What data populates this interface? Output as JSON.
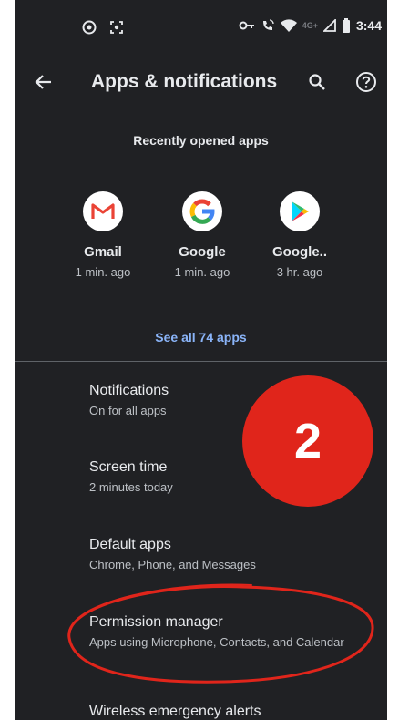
{
  "status_bar": {
    "time": "3:44",
    "network": "4G+",
    "icons": [
      "vpn-icon",
      "screen-record-icon",
      "key-icon",
      "wifi-calling-icon",
      "wifi-icon",
      "signal-icon",
      "battery-icon"
    ]
  },
  "toolbar": {
    "title": "Apps & notifications"
  },
  "recent": {
    "header": "Recently opened apps",
    "apps": [
      {
        "name": "Gmail",
        "time": "1 min. ago",
        "icon": "gmail-icon"
      },
      {
        "name": "Google",
        "time": "1 min. ago",
        "icon": "google-icon"
      },
      {
        "name": "Google..",
        "time": "3 hr. ago",
        "icon": "google-play-icon"
      }
    ],
    "see_all": "See all 74 apps"
  },
  "settings": [
    {
      "title": "Notifications",
      "subtitle": "On for all apps"
    },
    {
      "title": "Screen time",
      "subtitle": "2 minutes today"
    },
    {
      "title": "Default apps",
      "subtitle": "Chrome, Phone, and Messages"
    },
    {
      "title": "Permission manager",
      "subtitle": "Apps using Microphone, Contacts, and Calendar"
    },
    {
      "title": "Wireless emergency alerts",
      "subtitle": ""
    }
  ],
  "annotation": {
    "step_number": "2",
    "badge_color": "#e0251b",
    "circle_color": "#e0251b"
  },
  "colors": {
    "background": "#202124",
    "accent": "#8ab4f8",
    "text_primary": "#e8eaed",
    "text_secondary": "#bdc1c6"
  }
}
